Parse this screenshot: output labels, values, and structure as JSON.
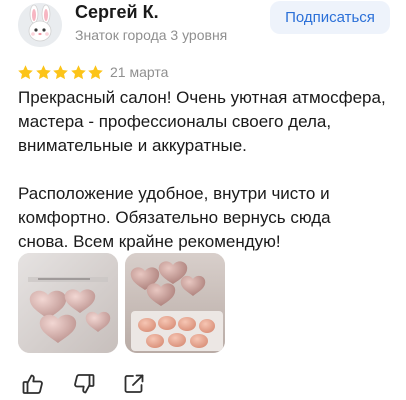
{
  "review": {
    "author": {
      "name": "Сергей К.",
      "level": "Знаток города 3 уровня",
      "avatar_icon": "bunny-face-icon"
    },
    "subscribe_label": "Подписаться",
    "rating": {
      "value": 5,
      "max": 5,
      "star_color": "#fcc419"
    },
    "date": "21 марта",
    "text_paragraphs": [
      "Прекрасный салон! Очень уютная атмосфера,\nмастера - профессионалы своего дела,\nвнимательные и аккуратные.",
      "Расположение удобное, внутри чисто и\nкомфортно. Обязательно вернусь сюда\nснова. Всем крайне рекомендую!"
    ],
    "photos": [
      {
        "icon": "heart-balloons-photo"
      },
      {
        "icon": "heart-balloons-tray-photo"
      }
    ],
    "actions": [
      {
        "icon": "thumbs-up-icon"
      },
      {
        "icon": "thumbs-down-icon"
      },
      {
        "icon": "share-icon"
      }
    ],
    "colors": {
      "accent": "#2b70d8",
      "accent_bg": "#eef3fb",
      "muted_text": "#8f8f8f"
    }
  }
}
